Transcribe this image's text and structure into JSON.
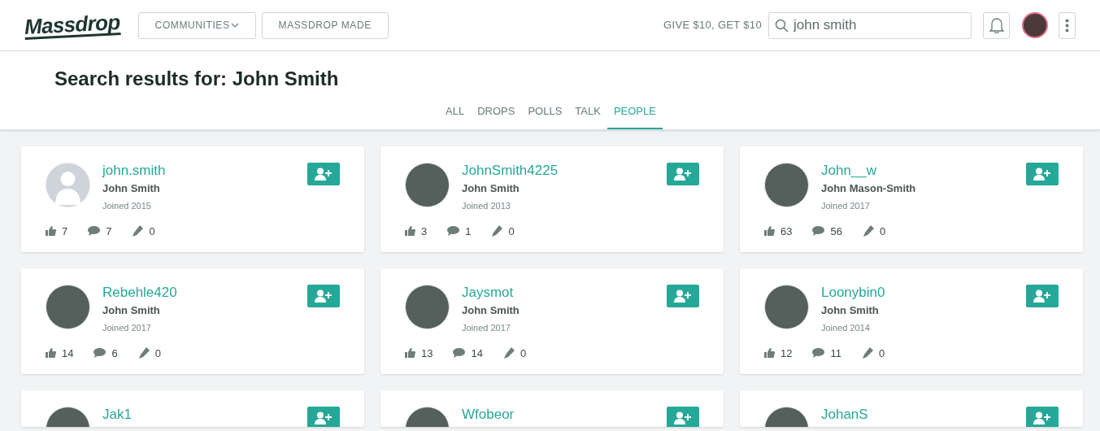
{
  "header": {
    "logo": "Massdrop",
    "nav": [
      {
        "label": "COMMUNITIES",
        "dropdown": true
      },
      {
        "label": "MASSDROP MADE",
        "dropdown": false
      }
    ],
    "promo": "GIVE $10, GET $10",
    "search": {
      "value": "john smith"
    }
  },
  "title": "Search results for: John Smith",
  "tabs": [
    {
      "label": "ALL",
      "selected": false
    },
    {
      "label": "DROPS",
      "selected": false
    },
    {
      "label": "POLLS",
      "selected": false
    },
    {
      "label": "TALK",
      "selected": false
    },
    {
      "label": "PEOPLE",
      "selected": true
    }
  ],
  "people": [
    {
      "username": "john.smith",
      "kind": "silhouette",
      "name": "John Smith",
      "joined": "Joined 2015",
      "likes": "7",
      "comments": "7",
      "posts": "0"
    },
    {
      "username": "JohnSmith4225",
      "kind": "photo",
      "name": "John Smith",
      "joined": "Joined 2013",
      "likes": "3",
      "comments": "1",
      "posts": "0"
    },
    {
      "username": "John__w",
      "kind": "photo",
      "name": "John Mason-Smith",
      "joined": "Joined 2017",
      "likes": "63",
      "comments": "56",
      "posts": "0"
    },
    {
      "username": "Rebehle420",
      "kind": "photo",
      "name": "John Smith",
      "joined": "Joined 2017",
      "likes": "14",
      "comments": "6",
      "posts": "0"
    },
    {
      "username": "Jaysmot",
      "kind": "photo",
      "name": "John Smith",
      "joined": "Joined 2017",
      "likes": "13",
      "comments": "14",
      "posts": "0"
    },
    {
      "username": "Loonybin0",
      "kind": "photo",
      "name": "John Smith",
      "joined": "Joined 2014",
      "likes": "12",
      "comments": "11",
      "posts": "0"
    },
    {
      "username": "Jak1",
      "kind": "photo"
    },
    {
      "username": "Wfobeor",
      "kind": "photo"
    },
    {
      "username": "JohanS",
      "kind": "photo"
    }
  ]
}
